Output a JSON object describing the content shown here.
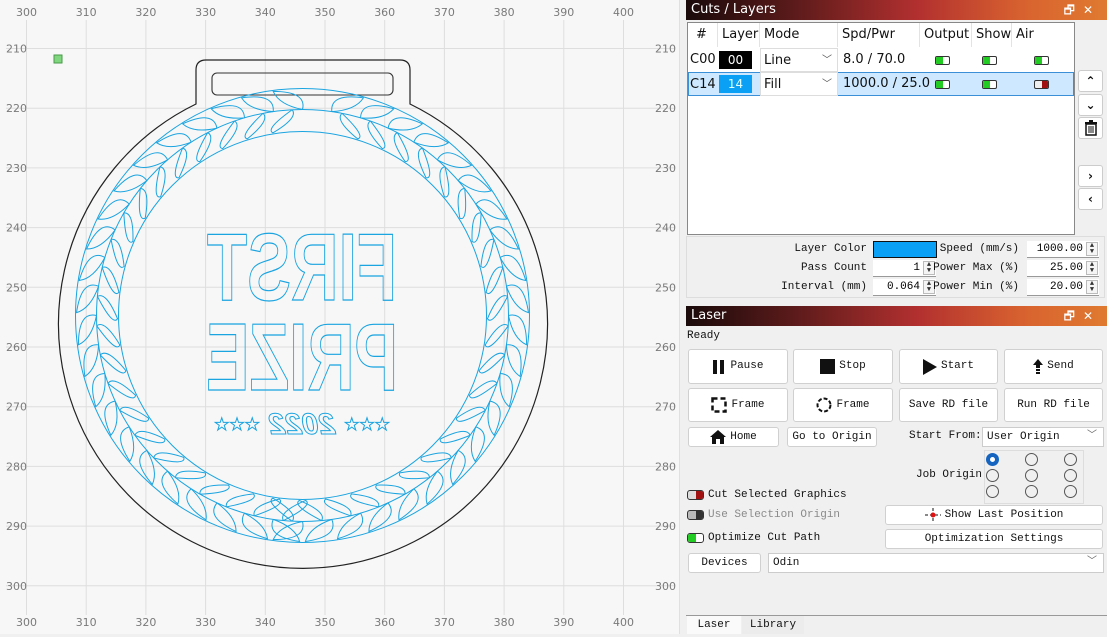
{
  "canvas": {
    "x_ticks": [
      "300",
      "310",
      "320",
      "330",
      "340",
      "350",
      "360",
      "370",
      "380",
      "390",
      "400"
    ],
    "y_ticks": [
      "210",
      "220",
      "230",
      "240",
      "250",
      "260",
      "270",
      "280",
      "290",
      "300"
    ],
    "design": {
      "text_line1": "FIRST",
      "text_line2": "PRIZE",
      "year": "2022",
      "stars": "★★★",
      "text_mirrored": true,
      "layer_color": "#00a0f0",
      "outline_color": "#222222",
      "origin_marker_color": "#7fd67f"
    }
  },
  "cuts_panel": {
    "title": "Cuts / Layers",
    "headers": [
      "#",
      "Layer",
      "Mode",
      "Spd/Pwr",
      "Output",
      "Show",
      "Air"
    ],
    "rows": [
      {
        "id": "C00",
        "layer": "00",
        "layer_color": "#000000",
        "mode": "Line",
        "spd_pwr": "8.0 / 70.0",
        "output": true,
        "show": true,
        "air": true,
        "selected": false
      },
      {
        "id": "C14",
        "layer": "14",
        "layer_color": "#0aa0f5",
        "mode": "Fill",
        "spd_pwr": "1000.0 / 25.0",
        "output": true,
        "show": true,
        "air": false,
        "selected": true
      }
    ],
    "side_buttons": [
      "move-up",
      "move-down",
      "delete",
      "next",
      "previous"
    ]
  },
  "layer_props": {
    "layer_color_label": "Layer Color",
    "layer_color": "#0aa0f5",
    "pass_count_label": "Pass Count",
    "pass_count": "1",
    "interval_label": "Interval (mm)",
    "interval": "0.064",
    "speed_label": "Speed (mm/s)",
    "speed": "1000.00",
    "power_max_label": "Power Max (%)",
    "power_max": "25.00",
    "power_min_label": "Power Min (%)",
    "power_min": "20.00"
  },
  "laser_panel": {
    "title": "Laser",
    "status": "Ready",
    "buttons": {
      "pause": "Pause",
      "stop": "Stop",
      "start": "Start",
      "send": "Send",
      "frame_rect": "Frame",
      "frame_circle": "Frame",
      "save_rd": "Save RD file",
      "run_rd": "Run RD file",
      "home": "Home",
      "go_origin": "Go to Origin",
      "show_last_position": "Show Last Position",
      "optimization_settings": "Optimization Settings",
      "devices": "Devices"
    },
    "start_from_label": "Start From:",
    "start_from_value": "User Origin",
    "job_origin_label": "Job Origin",
    "job_origin_selected": 0,
    "options": {
      "cut_selected": {
        "label": "Cut Selected Graphics",
        "on": false
      },
      "use_selection_origin": {
        "label": "Use Selection Origin",
        "on": false,
        "disabled": true
      },
      "optimize_cut_path": {
        "label": "Optimize Cut Path",
        "on": true
      }
    },
    "device_value": "Odin"
  },
  "bottom_tabs": [
    {
      "label": "Laser",
      "active": true
    },
    {
      "label": "Library",
      "active": false
    }
  ]
}
